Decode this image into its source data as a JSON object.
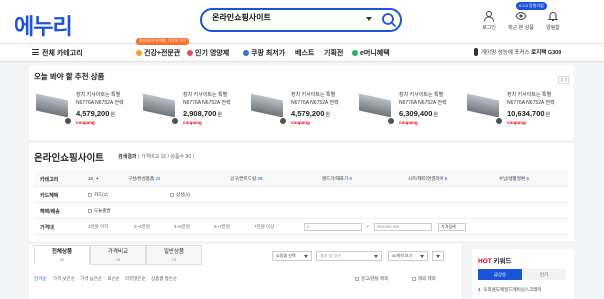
{
  "header": {
    "logo": "에누리",
    "search_value": "온라인쇼핑사이트",
    "event_tag": "9.3.5 응원기업",
    "icons": [
      {
        "name": "user-icon",
        "label": "로그인"
      },
      {
        "name": "eye-icon",
        "label": "최근 본 상품"
      },
      {
        "name": "bell-icon",
        "label": "알림함"
      }
    ]
  },
  "nav": {
    "all_category": "전체 카테고리",
    "badge": "중분류/대 위치별, 가짐이 가이",
    "items": [
      {
        "label": "건강+전문관",
        "color": "#f4a024"
      },
      {
        "label": "인기 영양제",
        "color": "#e84a5f"
      },
      {
        "label": "쿠팡 최저가",
        "color": "#3a6ee8"
      },
      {
        "label": "베스트",
        "color": ""
      },
      {
        "label": "기획전",
        "color": ""
      },
      {
        "label": "e머니혜택",
        "color": "#1fb66a"
      }
    ],
    "promo_text": "게이밍 성능에 포커스",
    "promo_brand": "로지텍 G309"
  },
  "recommend": {
    "title": "오늘 봐야 할 추천 상품",
    "ad_label": "광고",
    "products": [
      {
        "name": "장치 키사이트는 특별 N6776A N6752A 전력 N...",
        "price": "4,579,200",
        "won": "원",
        "shop": "coupang"
      },
      {
        "name": "장치 키사이트는 특별 N6776A N6752A 전력 N...",
        "price": "2,908,700",
        "won": "원",
        "shop": "coupang"
      },
      {
        "name": "장치 키사이트는 특별 N6776A N6752A 전력 N...",
        "price": "4,579,200",
        "won": "원",
        "shop": "coupang"
      },
      {
        "name": "장치 키사이트는 특별 N6776A N6752A 전력 N...",
        "price": "6,309,400",
        "won": "원",
        "shop": "coupang"
      },
      {
        "name": "장치 키사이트는 특별 N6776A N6752A 전력 N...",
        "price": "10,634,700",
        "won": "원",
        "shop": "coupang"
      }
    ]
  },
  "result": {
    "keyword": "온라인쇼핑사이트",
    "suffix": "검색결과",
    "counts": "( 가격비교 16 / 상품수 90 )"
  },
  "filters": {
    "category_label": "카테고리",
    "category_count": "16",
    "categories": [
      {
        "label": "구성/완성품품",
        "count": "24"
      },
      {
        "label": "공구/컨트드릴",
        "count": "28"
      },
      {
        "label": "랜드기/재료기",
        "count": "8"
      },
      {
        "label": "시트/제트/연결리어",
        "count": "6"
      },
      {
        "label": "수납/생활절환",
        "count": "5"
      }
    ],
    "card_label": "카드혜택",
    "card_opts": [
      "카드(1)",
      "삼성(1)"
    ],
    "delivery_label": "혜택/배송",
    "delivery_opt": "오늘출발",
    "price_label": "가격대",
    "price_ranges": [
      "2만원 이하",
      "2~4만원",
      "4~6만원",
      "6~7만원",
      "7만원 이상"
    ],
    "price_min": "0",
    "price_max": "999,999,999",
    "price_btn": "가격검색"
  },
  "tabs": [
    {
      "label": "전체상품",
      "count": "90"
    },
    {
      "label": "가격비교",
      "count": "16"
    },
    {
      "label": "일반상품",
      "count": "74"
    }
  ],
  "toolbar": {
    "shop_select": "쇼핑몰 선택",
    "search_in": "결과 내 검색",
    "view_count": "40개씩 보기"
  },
  "sort": {
    "active": "인기순",
    "others": [
      "가격 낮은순",
      "가격 높은순",
      "최신순",
      "리뷰많은순",
      "상품평 많은순"
    ],
    "checks": [
      "중고/렌탈 제외",
      "해외 제외"
    ]
  },
  "hot": {
    "title_hot": "HOT",
    "title_rest": "키워드",
    "tabs": [
      "급상승",
      "인기"
    ],
    "rank_no": "1",
    "rank_text": "오라클도메일드레이닝스크레이"
  }
}
